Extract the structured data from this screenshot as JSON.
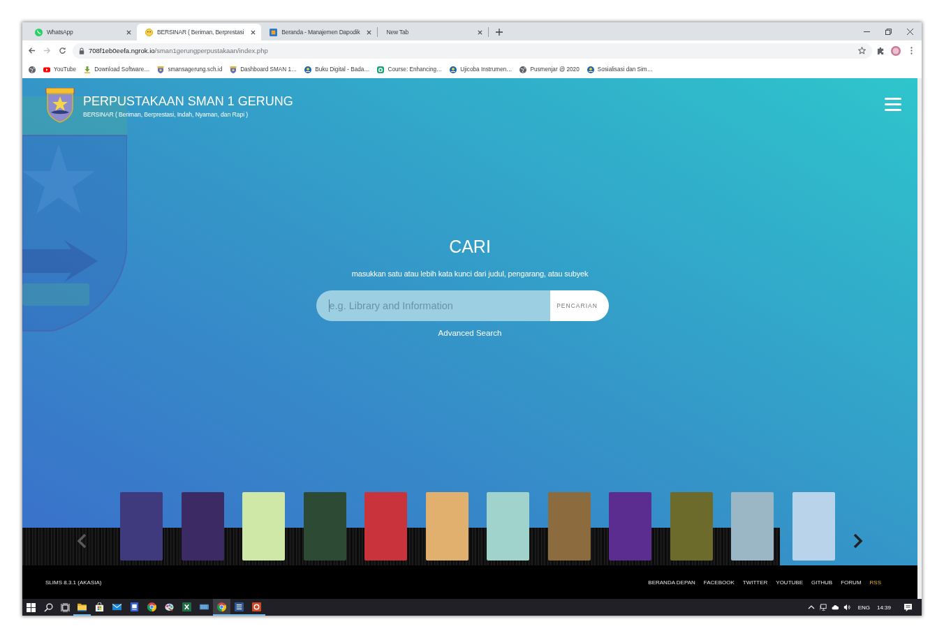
{
  "browser": {
    "tabs": [
      {
        "title": "WhatsApp",
        "kind": "whatsapp",
        "selected": false
      },
      {
        "title": "BERSINAR ( Beriman, Berprestasi",
        "kind": "smiley",
        "selected": true
      },
      {
        "title": "Beranda - Manajemen Dapodik",
        "kind": "dapodik",
        "selected": false
      },
      {
        "title": "New Tab",
        "selected": false
      }
    ],
    "forward_disabled": true,
    "address": {
      "host": "708f1eb0eefa.ngrok.io",
      "path": "/sman1gerungperpustakaan/index.php"
    },
    "bookmarks": [
      {
        "kind": "globe"
      },
      {
        "kind": "youtube",
        "label": "YouTube"
      },
      {
        "kind": "download",
        "label": "Download Software…"
      },
      {
        "kind": "school",
        "label": "smansagerung.sch.id"
      },
      {
        "kind": "school",
        "label": "Dashboard SMAN 1…"
      },
      {
        "kind": "ministry",
        "label": "Buku Digital - Bada…"
      },
      {
        "kind": "course",
        "label": "Course: Enhancing…"
      },
      {
        "kind": "ministry",
        "label": "Ujicoba Instrumen…"
      },
      {
        "kind": "globe",
        "label": "Pusmenjar @ 2020"
      },
      {
        "kind": "ministry",
        "label": "Sosialisasi dan Sim…"
      }
    ]
  },
  "site": {
    "title": "PERPUSTAKAAN SMAN 1 GERUNG",
    "tagline": "BERSINAR ( Beriman, Berprestasi, Indah, Nyaman, dan Rapi )"
  },
  "search": {
    "heading": "CARI",
    "hint": "masukkan satu atau lebih kata kunci dari judul, pengarang, atau subyek",
    "placeholder": "e.g. Library and Information",
    "focused": true,
    "button": "PENCARIAN",
    "advanced_link": "Advanced Search"
  },
  "carousel": {
    "books": [
      {
        "color": "#3f3a7e"
      },
      {
        "color": "#3b2a63"
      },
      {
        "color": "#cfe8a8"
      },
      {
        "color": "#2d4a34"
      },
      {
        "color": "#c9343c"
      },
      {
        "color": "#e2b06e"
      },
      {
        "color": "#9fd3cc"
      },
      {
        "color": "#8c6b3e"
      },
      {
        "color": "#5b2d91"
      },
      {
        "color": "#6d6b2c"
      },
      {
        "color": "#9bb6c4"
      },
      {
        "color": "#b9d3ea"
      }
    ]
  },
  "footer": {
    "version": "SLIMS 8.3.1 (AKASIA)",
    "links": [
      {
        "label": "BERANDA DEPAN",
        "highlighted": false
      },
      {
        "label": "FACEBOOK",
        "highlighted": false
      },
      {
        "label": "TWITTER",
        "highlighted": false
      },
      {
        "label": "YOUTUBE",
        "highlighted": false
      },
      {
        "label": "GITHUB",
        "highlighted": false
      },
      {
        "label": "FORUM",
        "highlighted": false
      },
      {
        "label": "RSS",
        "highlighted": true
      }
    ]
  },
  "taskbar": {
    "apps": [
      {
        "kind": "explorer",
        "running": true,
        "selected": false
      },
      {
        "kind": "store",
        "running": false,
        "selected": false
      },
      {
        "kind": "mail",
        "running": false,
        "selected": false
      },
      {
        "kind": "document",
        "running": false,
        "selected": false
      },
      {
        "kind": "chrome",
        "running": false,
        "selected": false
      },
      {
        "kind": "paint",
        "running": false,
        "selected": false
      },
      {
        "kind": "excel",
        "running": false,
        "selected": false
      },
      {
        "kind": "keyboard",
        "running": false,
        "selected": false
      },
      {
        "kind": "chrome",
        "running": true,
        "selected": true
      },
      {
        "kind": "word",
        "running": true,
        "selected": false
      },
      {
        "kind": "powerpoint",
        "running": true,
        "selected": false
      }
    ],
    "language": "ENG",
    "time": "14:39"
  }
}
